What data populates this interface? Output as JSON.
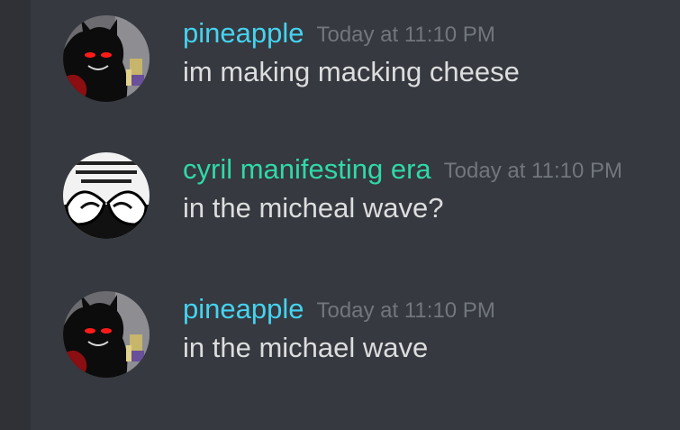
{
  "messages": [
    {
      "avatar_icon": "pineapple-avatar-icon",
      "username": "pineapple",
      "username_color": "#45d3f0",
      "timestamp": "Today at 11:10 PM",
      "text": "im making macking cheese"
    },
    {
      "avatar_icon": "cyril-avatar-icon",
      "username": "cyril manifesting era",
      "username_color": "#2fd9a8",
      "timestamp": "Today at 11:10 PM",
      "text": "in the micheal wave?"
    },
    {
      "avatar_icon": "pineapple-avatar-icon",
      "username": "pineapple",
      "username_color": "#45d3f0",
      "timestamp": "Today at 11:10 PM",
      "text": "in the michael wave"
    }
  ],
  "colors": {
    "background": "#36393f",
    "text": "#dcddde",
    "timestamp": "#72767d"
  }
}
